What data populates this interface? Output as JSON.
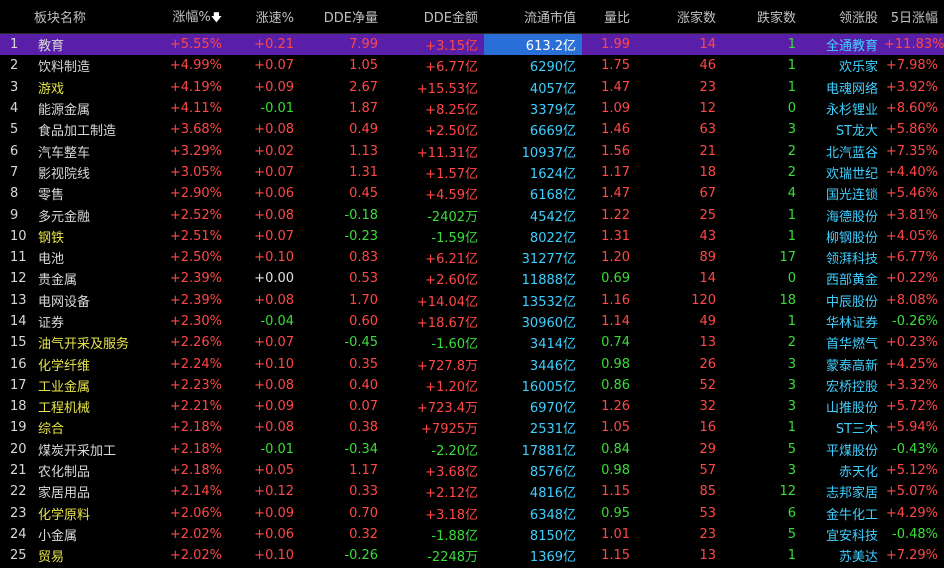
{
  "headers": {
    "sector": "板块名称",
    "change": "涨幅%",
    "sort_icon": "down-arrow-icon",
    "speed": "涨速%",
    "dde_net": "DDE净量",
    "dde_amount": "DDE金额",
    "mcap": "流通市值",
    "volume_ratio": "量比",
    "up_count": "涨家数",
    "down_count": "跌家数",
    "leader": "领涨股",
    "five_day": "5日涨幅"
  },
  "rows": [
    {
      "idx": "1",
      "name": "教育",
      "change": "+5.55%",
      "speed": "+0.21",
      "dde_net": "7.99",
      "dde_amount": "+3.15亿",
      "mcap": "613.2亿",
      "vr": "1.99",
      "up": "14",
      "down": "1",
      "leader": "全通教育",
      "five_day": "+11.83%"
    },
    {
      "idx": "2",
      "name": "饮料制造",
      "change": "+4.99%",
      "speed": "+0.07",
      "dde_net": "1.05",
      "dde_amount": "+6.77亿",
      "mcap": "6290亿",
      "vr": "1.75",
      "up": "46",
      "down": "1",
      "leader": "欢乐家",
      "five_day": "+7.98%"
    },
    {
      "idx": "3",
      "name": "游戏",
      "change": "+4.19%",
      "speed": "+0.09",
      "dde_net": "2.67",
      "dde_amount": "+15.53亿",
      "mcap": "4057亿",
      "vr": "1.47",
      "up": "23",
      "down": "1",
      "leader": "电魂网络",
      "five_day": "+3.92%"
    },
    {
      "idx": "4",
      "name": "能源金属",
      "change": "+4.11%",
      "speed": "-0.01",
      "dde_net": "1.87",
      "dde_amount": "+8.25亿",
      "mcap": "3379亿",
      "vr": "1.09",
      "up": "12",
      "down": "0",
      "leader": "永杉锂业",
      "five_day": "+8.60%"
    },
    {
      "idx": "5",
      "name": "食品加工制造",
      "change": "+3.68%",
      "speed": "+0.08",
      "dde_net": "0.49",
      "dde_amount": "+2.50亿",
      "mcap": "6669亿",
      "vr": "1.46",
      "up": "63",
      "down": "3",
      "leader": "ST龙大",
      "five_day": "+5.86%"
    },
    {
      "idx": "6",
      "name": "汽车整车",
      "change": "+3.29%",
      "speed": "+0.02",
      "dde_net": "1.13",
      "dde_amount": "+11.31亿",
      "mcap": "10937亿",
      "vr": "1.56",
      "up": "21",
      "down": "2",
      "leader": "北汽蓝谷",
      "five_day": "+7.35%"
    },
    {
      "idx": "7",
      "name": "影视院线",
      "change": "+3.05%",
      "speed": "+0.07",
      "dde_net": "1.31",
      "dde_amount": "+1.57亿",
      "mcap": "1624亿",
      "vr": "1.17",
      "up": "18",
      "down": "2",
      "leader": "欢瑞世纪",
      "five_day": "+4.40%"
    },
    {
      "idx": "8",
      "name": "零售",
      "change": "+2.90%",
      "speed": "+0.06",
      "dde_net": "0.45",
      "dde_amount": "+4.59亿",
      "mcap": "6168亿",
      "vr": "1.47",
      "up": "67",
      "down": "4",
      "leader": "国光连锁",
      "five_day": "+5.46%"
    },
    {
      "idx": "9",
      "name": "多元金融",
      "change": "+2.52%",
      "speed": "+0.08",
      "dde_net": "-0.18",
      "dde_amount": "-2402万",
      "mcap": "4542亿",
      "vr": "1.22",
      "up": "25",
      "down": "1",
      "leader": "海德股份",
      "five_day": "+3.81%"
    },
    {
      "idx": "10",
      "name": "钢铁",
      "change": "+2.51%",
      "speed": "+0.07",
      "dde_net": "-0.23",
      "dde_amount": "-1.59亿",
      "mcap": "8022亿",
      "vr": "1.31",
      "up": "43",
      "down": "1",
      "leader": "柳钢股份",
      "five_day": "+4.05%"
    },
    {
      "idx": "11",
      "name": "电池",
      "change": "+2.50%",
      "speed": "+0.10",
      "dde_net": "0.83",
      "dde_amount": "+6.21亿",
      "mcap": "31277亿",
      "vr": "1.20",
      "up": "89",
      "down": "17",
      "leader": "领湃科技",
      "five_day": "+6.77%"
    },
    {
      "idx": "12",
      "name": "贵金属",
      "change": "+2.39%",
      "speed": "+0.00",
      "dde_net": "0.53",
      "dde_amount": "+2.60亿",
      "mcap": "11888亿",
      "vr": "0.69",
      "up": "14",
      "down": "0",
      "leader": "西部黄金",
      "five_day": "+0.22%"
    },
    {
      "idx": "13",
      "name": "电网设备",
      "change": "+2.39%",
      "speed": "+0.08",
      "dde_net": "1.70",
      "dde_amount": "+14.04亿",
      "mcap": "13532亿",
      "vr": "1.16",
      "up": "120",
      "down": "18",
      "leader": "中辰股份",
      "five_day": "+8.08%"
    },
    {
      "idx": "14",
      "name": "证券",
      "change": "+2.30%",
      "speed": "-0.04",
      "dde_net": "0.60",
      "dde_amount": "+18.67亿",
      "mcap": "30960亿",
      "vr": "1.14",
      "up": "49",
      "down": "1",
      "leader": "华林证券",
      "five_day": "-0.26%"
    },
    {
      "idx": "15",
      "name": "油气开采及服务",
      "change": "+2.26%",
      "speed": "+0.07",
      "dde_net": "-0.45",
      "dde_amount": "-1.60亿",
      "mcap": "3414亿",
      "vr": "0.74",
      "up": "13",
      "down": "2",
      "leader": "首华燃气",
      "five_day": "+0.23%"
    },
    {
      "idx": "16",
      "name": "化学纤维",
      "change": "+2.24%",
      "speed": "+0.10",
      "dde_net": "0.35",
      "dde_amount": "+727.8万",
      "mcap": "3446亿",
      "vr": "0.98",
      "up": "26",
      "down": "3",
      "leader": "蒙泰高新",
      "five_day": "+4.25%"
    },
    {
      "idx": "17",
      "name": "工业金属",
      "change": "+2.23%",
      "speed": "+0.08",
      "dde_net": "0.40",
      "dde_amount": "+1.20亿",
      "mcap": "16005亿",
      "vr": "0.86",
      "up": "52",
      "down": "3",
      "leader": "宏桥控股",
      "five_day": "+3.32%"
    },
    {
      "idx": "18",
      "name": "工程机械",
      "change": "+2.21%",
      "speed": "+0.09",
      "dde_net": "0.07",
      "dde_amount": "+723.4万",
      "mcap": "6970亿",
      "vr": "1.26",
      "up": "32",
      "down": "3",
      "leader": "山推股份",
      "five_day": "+5.72%"
    },
    {
      "idx": "19",
      "name": "综合",
      "change": "+2.18%",
      "speed": "+0.08",
      "dde_net": "0.38",
      "dde_amount": "+7925万",
      "mcap": "2531亿",
      "vr": "1.05",
      "up": "16",
      "down": "1",
      "leader": "ST三木",
      "five_day": "+5.94%"
    },
    {
      "idx": "20",
      "name": "煤炭开采加工",
      "change": "+2.18%",
      "speed": "-0.01",
      "dde_net": "-0.34",
      "dde_amount": "-2.20亿",
      "mcap": "17881亿",
      "vr": "0.84",
      "up": "29",
      "down": "5",
      "leader": "平煤股份",
      "five_day": "-0.43%"
    },
    {
      "idx": "21",
      "name": "农化制品",
      "change": "+2.18%",
      "speed": "+0.05",
      "dde_net": "1.17",
      "dde_amount": "+3.68亿",
      "mcap": "8576亿",
      "vr": "0.98",
      "up": "57",
      "down": "3",
      "leader": "赤天化",
      "five_day": "+5.12%"
    },
    {
      "idx": "22",
      "name": "家居用品",
      "change": "+2.14%",
      "speed": "+0.12",
      "dde_net": "0.33",
      "dde_amount": "+2.12亿",
      "mcap": "4816亿",
      "vr": "1.15",
      "up": "85",
      "down": "12",
      "leader": "志邦家居",
      "five_day": "+5.07%"
    },
    {
      "idx": "23",
      "name": "化学原料",
      "change": "+2.06%",
      "speed": "+0.09",
      "dde_net": "0.70",
      "dde_amount": "+3.18亿",
      "mcap": "6348亿",
      "vr": "0.95",
      "up": "53",
      "down": "6",
      "leader": "金牛化工",
      "five_day": "+4.29%"
    },
    {
      "idx": "24",
      "name": "小金属",
      "change": "+2.02%",
      "speed": "+0.06",
      "dde_net": "0.32",
      "dde_amount": "-1.88亿",
      "mcap": "8150亿",
      "vr": "1.01",
      "up": "23",
      "down": "5",
      "leader": "宜安科技",
      "five_day": "-0.48%"
    },
    {
      "idx": "25",
      "name": "贸易",
      "change": "+2.02%",
      "speed": "+0.10",
      "dde_net": "-0.26",
      "dde_amount": "-2248万",
      "mcap": "1369亿",
      "vr": "1.15",
      "up": "13",
      "down": "1",
      "leader": "苏美达",
      "five_day": "+7.29%"
    }
  ],
  "highlighted_names": [
    "游戏",
    "钢铁",
    "油气开采及服务",
    "化学纤维",
    "工业金属",
    "工程机械",
    "综合",
    "化学原料",
    "贸易"
  ],
  "selected_row": 0,
  "colors": {
    "up": "#ff4747",
    "down": "#3bdc3b",
    "neutral": "#e0e0e0",
    "mcap": "#3fcfff",
    "highlight_name": "#e6e34a",
    "selected_bg": "#5a1fa8"
  }
}
